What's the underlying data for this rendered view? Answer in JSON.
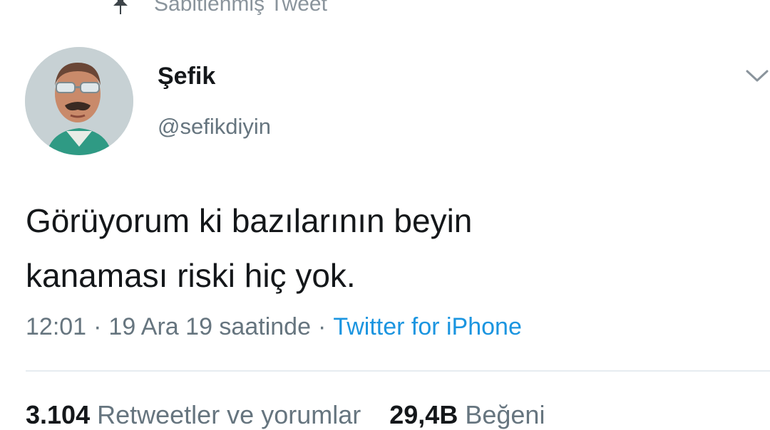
{
  "pinned": {
    "label": "Sabitlenmiş Tweet",
    "icon": "pin-icon"
  },
  "author": {
    "display_name": "Şefik",
    "handle": "@sefikdiyin",
    "avatar": "avatar"
  },
  "menu": {
    "icon": "chevron-down-icon"
  },
  "tweet": {
    "lines": [
      "Görüyorum ki bazılarının beyin",
      "kanaması riski hiç yok."
    ],
    "time": "12:01",
    "date": "19 Ara 19 saatinde",
    "source": "Twitter for iPhone"
  },
  "stats": {
    "retweets_count": "3.104",
    "retweets_label": "Retweetler ve yorumlar",
    "likes_count": "29,4B",
    "likes_label": "Beğeni"
  },
  "colors": {
    "link": "#1b95e0",
    "secondary_text": "#66757f",
    "primary_text": "#14171a",
    "divider": "#e6ecf0"
  }
}
